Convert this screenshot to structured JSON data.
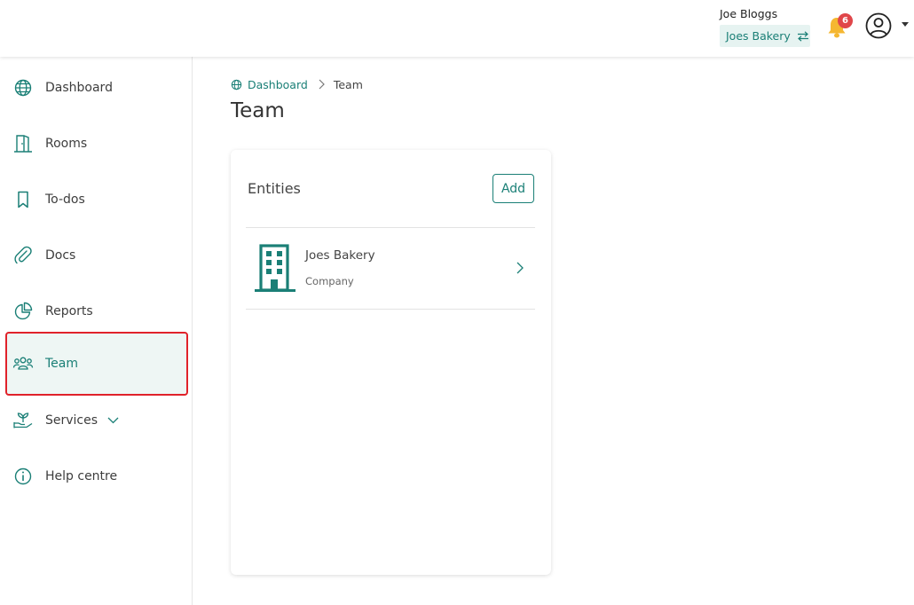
{
  "header": {
    "user_name": "Joe Bloggs",
    "company": "Joes Bakery",
    "notification_count": "6",
    "accent_color": "#1a7f76",
    "badge_color": "#e0464a",
    "bell_color": "#f5b731"
  },
  "sidebar": {
    "items": [
      {
        "label": "Dashboard",
        "icon": "globe-icon"
      },
      {
        "label": "Rooms",
        "icon": "door-icon"
      },
      {
        "label": "To-dos",
        "icon": "bookmark-icon"
      },
      {
        "label": "Docs",
        "icon": "paperclip-icon"
      },
      {
        "label": "Reports",
        "icon": "pie-chart-icon"
      },
      {
        "label": "Team",
        "icon": "team-icon",
        "active": true
      },
      {
        "label": "Services",
        "icon": "plant-hand-icon"
      },
      {
        "label": "Help centre",
        "icon": "info-icon"
      }
    ]
  },
  "breadcrumb": {
    "home": "Dashboard",
    "current": "Team"
  },
  "page": {
    "title": "Team"
  },
  "entities_card": {
    "title": "Entities",
    "add_label": "Add",
    "items": [
      {
        "name": "Joes Bakery",
        "type": "Company",
        "icon": "building-icon"
      }
    ]
  }
}
